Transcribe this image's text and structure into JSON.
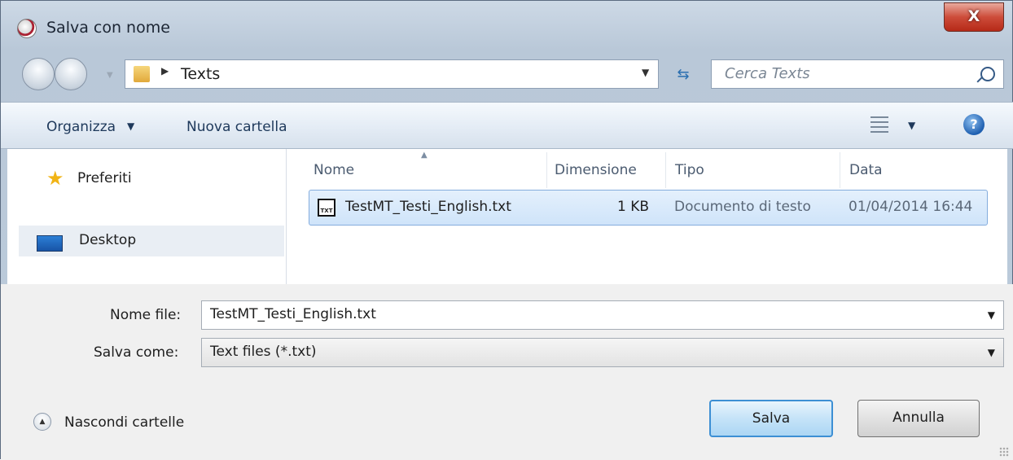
{
  "window": {
    "title": "Salva con nome",
    "close_label": "X"
  },
  "address_bar": {
    "crumbs": [
      "Texts"
    ]
  },
  "search": {
    "placeholder": "Cerca Texts"
  },
  "toolbar": {
    "organize_label": "Organizza",
    "new_folder_label": "Nuova cartella"
  },
  "nav_pane": {
    "favorites_label": "Preferiti",
    "desktop_label": "Desktop"
  },
  "file_list": {
    "columns": [
      "Nome",
      "Dimensione",
      "Tipo",
      "Data"
    ],
    "rows": [
      {
        "name": "TestMT_Testi_English.txt",
        "size": "1 KB",
        "type": "Documento di testo",
        "date": "01/04/2014 16:44"
      }
    ]
  },
  "form": {
    "filename_label": "Nome file:",
    "filename_value": "TestMT_Testi_English.txt",
    "savetype_label": "Salva come:",
    "savetype_value": "Text files (*.txt)"
  },
  "footer": {
    "hide_folders_label": "Nascondi cartelle",
    "save_label": "Salva",
    "cancel_label": "Annulla"
  },
  "icons": {
    "app": "app-icon",
    "back": "back-arrow-icon",
    "forward": "forward-arrow-icon",
    "folder": "folder-icon",
    "refresh": "refresh-icon",
    "search": "search-icon",
    "view": "view-options-icon",
    "help": "help-icon",
    "favorites": "star-icon",
    "desktop": "desktop-icon",
    "file": "txt-file-icon"
  },
  "colors": {
    "selection": "#cfe4fa",
    "close_button": "#cd4c3a",
    "default_button_border": "#3c8fd4"
  }
}
